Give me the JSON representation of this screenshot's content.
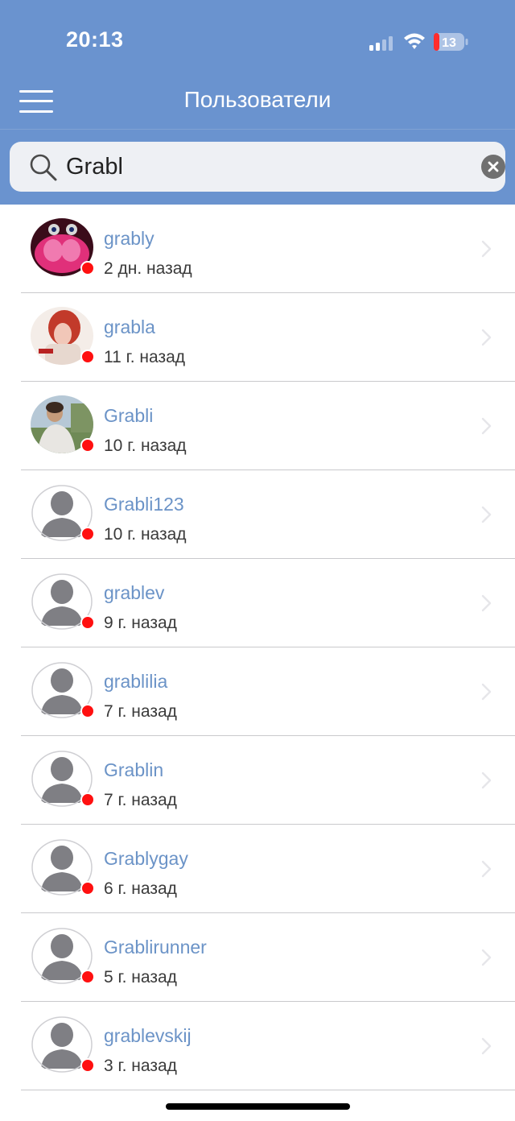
{
  "status_bar": {
    "time": "20:13",
    "battery_level": "13",
    "icons": [
      "cellular-signal-icon",
      "wifi-icon",
      "battery-icon"
    ]
  },
  "nav": {
    "title": "Пользователи",
    "menu_icon": "hamburger-menu-icon"
  },
  "search": {
    "value": "Grabl",
    "icon": "search-icon",
    "clear_icon": "clear-icon"
  },
  "users": [
    {
      "name": "grably",
      "last_seen": "2 дн. назад",
      "avatar": "photo-pink-creature"
    },
    {
      "name": "grabla",
      "last_seen": "11 г. назад",
      "avatar": "photo-red-figure"
    },
    {
      "name": "Grabli",
      "last_seen": "10 г. назад",
      "avatar": "photo-person-outdoors"
    },
    {
      "name": "Grabli123",
      "last_seen": "10 г. назад",
      "avatar": "default-avatar"
    },
    {
      "name": "grablev",
      "last_seen": "9 г. назад",
      "avatar": "default-avatar"
    },
    {
      "name": "grablilia",
      "last_seen": "7 г. назад",
      "avatar": "default-avatar"
    },
    {
      "name": "Grablin",
      "last_seen": "7 г. назад",
      "avatar": "default-avatar"
    },
    {
      "name": "Grablygay",
      "last_seen": "6 г. назад",
      "avatar": "default-avatar"
    },
    {
      "name": "Grablirunner",
      "last_seen": "5 г. назад",
      "avatar": "default-avatar"
    },
    {
      "name": "grablevskij",
      "last_seen": "3 г. назад",
      "avatar": "default-avatar"
    }
  ],
  "colors": {
    "header": "#6a93cf",
    "username": "#6b93c7",
    "online_status": "#ff1010",
    "separator": "#c9c9cc"
  }
}
